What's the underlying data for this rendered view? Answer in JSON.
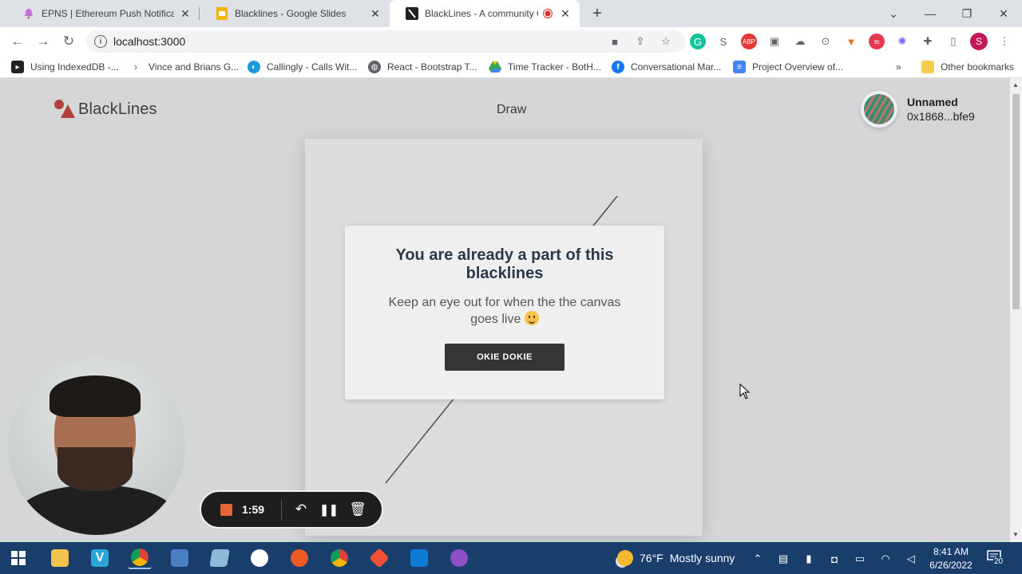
{
  "tabs": [
    {
      "title": "EPNS | Ethereum Push Notificatio",
      "icon": "bell-icon",
      "color": "#c56fd8"
    },
    {
      "title": "Blacklines - Google Slides",
      "icon": "slides-icon",
      "color": "#f4b400"
    },
    {
      "title": "BlackLines - A community G",
      "icon": "blacklines-icon",
      "color": "#202124",
      "recording": true
    }
  ],
  "toolbar": {
    "url": "localhost:3000"
  },
  "bookmarks": [
    {
      "label": "Using IndexedDB -...",
      "icon": "bookmark-icon",
      "color": "#222222"
    },
    {
      "label": "Vince and Brians G...",
      "icon": "arrow-bookmark-icon",
      "color": "#555555"
    },
    {
      "label": "Callingly - Calls Wit...",
      "icon": "callingly-icon",
      "color": "#1a9be0"
    },
    {
      "label": "React - Bootstrap T...",
      "icon": "globe-icon",
      "color": "#5f6368"
    },
    {
      "label": "Time Tracker - BotH...",
      "icon": "drive-icon",
      "color": "#34a853"
    },
    {
      "label": "Conversational Mar...",
      "icon": "facebook-icon",
      "color": "#1877f2"
    },
    {
      "label": "Project Overview of...",
      "icon": "docs-icon",
      "color": "#4285f4"
    }
  ],
  "other_bookmarks": "Other bookmarks",
  "more_bookmarks": "»",
  "app": {
    "logo": "BlackLines",
    "nav_draw": "Draw",
    "user_name": "Unnamed",
    "user_address": "0x1868...bfe9"
  },
  "modal": {
    "title": "You are already a part of this blacklines",
    "body": "Keep an eye out for when the the canvas goes live",
    "button": "OKIE DOKIE"
  },
  "recorder": {
    "time": "1:59"
  },
  "taskbar": {
    "weather_temp": "76°F",
    "weather_text": "Mostly sunny",
    "time": "8:41 AM",
    "date": "6/26/2022",
    "notifications": "20"
  },
  "colors": {
    "accent": "#b2403a",
    "button": "#353535",
    "taskbar": "#1a3e6c"
  }
}
